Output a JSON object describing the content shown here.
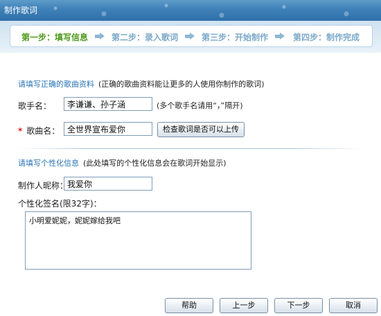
{
  "window": {
    "title": "制作歌词"
  },
  "steps": [
    {
      "label": "第一步：填写信息",
      "active": true
    },
    {
      "label": "第二步：录入歌词",
      "active": false
    },
    {
      "label": "第三步：开始制作",
      "active": false
    },
    {
      "label": "第四步：制作完成",
      "active": false
    }
  ],
  "song_info": {
    "title": "请填写正确的歌曲资料",
    "hint": "(正确的歌曲资料能让更多的人使用你制作的歌词)",
    "singer_label": "歌手名：",
    "singer_value": "李谦谦、孙子涵",
    "singer_hint": "(多个歌手名请用“，”隔开)",
    "required_mark": "*",
    "song_label": "歌曲名：",
    "song_value": "全世界宣布爱你",
    "check_button": "检查歌词是否可以上传"
  },
  "personal_info": {
    "title": "请填写个性化信息",
    "hint": "(此处填写的个性化信息会在歌词开始显示)",
    "nickname_label": "制作人昵称：",
    "nickname_value": "我爱你",
    "signature_label": "个性化签名(限32字)：",
    "signature_value": "小明爱妮妮，妮妮嫁给我吧"
  },
  "buttons": {
    "help": "帮助",
    "prev": "上一步",
    "next": "下一步",
    "cancel": "取消"
  },
  "colors": {
    "active_step": "#4f9a1e",
    "inactive_step": "#7ca9c9",
    "section_title": "#2a74b5",
    "required": "#e02020"
  }
}
